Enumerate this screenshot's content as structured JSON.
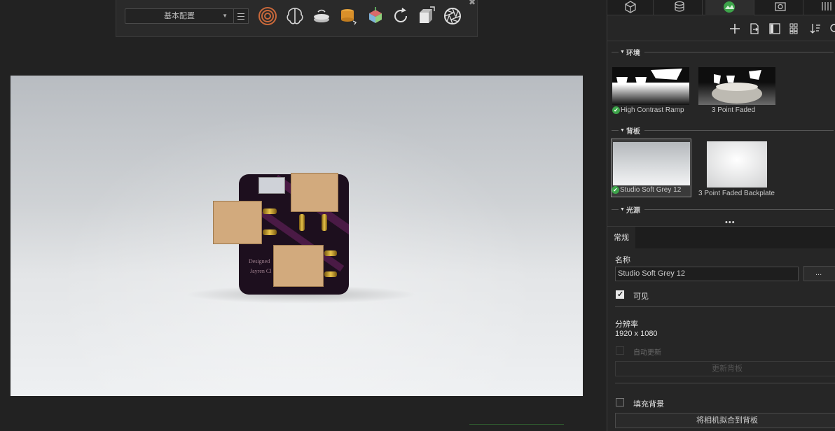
{
  "toolbar": {
    "config_select": "基本配置",
    "icons": [
      "target-rings-icon",
      "brain-icon",
      "turntable-icon",
      "cylinder-swap-icon",
      "cube-axes-icon",
      "refresh-icon",
      "box-move-icon",
      "aperture-icon"
    ]
  },
  "viewport": {
    "board_text_line1": "Designed",
    "board_text_line2": "Jayren Cl"
  },
  "panel": {
    "tabs": [
      "cube-tab-icon",
      "database-tab-icon",
      "environment-tab-icon",
      "camera-tab-icon",
      "columns-tab-icon"
    ],
    "active_tab": "environment-tab-icon",
    "tools": [
      "add-icon",
      "import-icon",
      "layout-icon",
      "grid-icon",
      "sort-icon",
      "search-icon"
    ],
    "sections": {
      "environment": "环境",
      "backplate": "背板",
      "lights": "光源"
    },
    "environment_items": [
      {
        "label": "High Contrast Ramp",
        "active": true
      },
      {
        "label": "3 Point Faded",
        "active": false
      }
    ],
    "backplate_items": [
      {
        "label": "Studio Soft Grey 12",
        "active": true
      },
      {
        "label": "3 Point Faded Backplate",
        "active": false
      }
    ],
    "splitter": "•••"
  },
  "properties": {
    "tab": "常规",
    "name_label": "名称",
    "name_value": "Studio Soft Grey 12",
    "browse_label": "...",
    "visible_label": "可见",
    "visible_checked": true,
    "resolution_label": "分辨率",
    "resolution_value": "1920 x 1080",
    "auto_update_label": "自动更新",
    "update_button": "更新背板",
    "fill_bg_label": "填充背景",
    "fill_bg_checked": false,
    "fit_camera_button": "将相机拟合到背板"
  },
  "colors": {
    "accent_green": "#3da44a",
    "panel_bg": "#262626",
    "app_bg": "#222222"
  }
}
